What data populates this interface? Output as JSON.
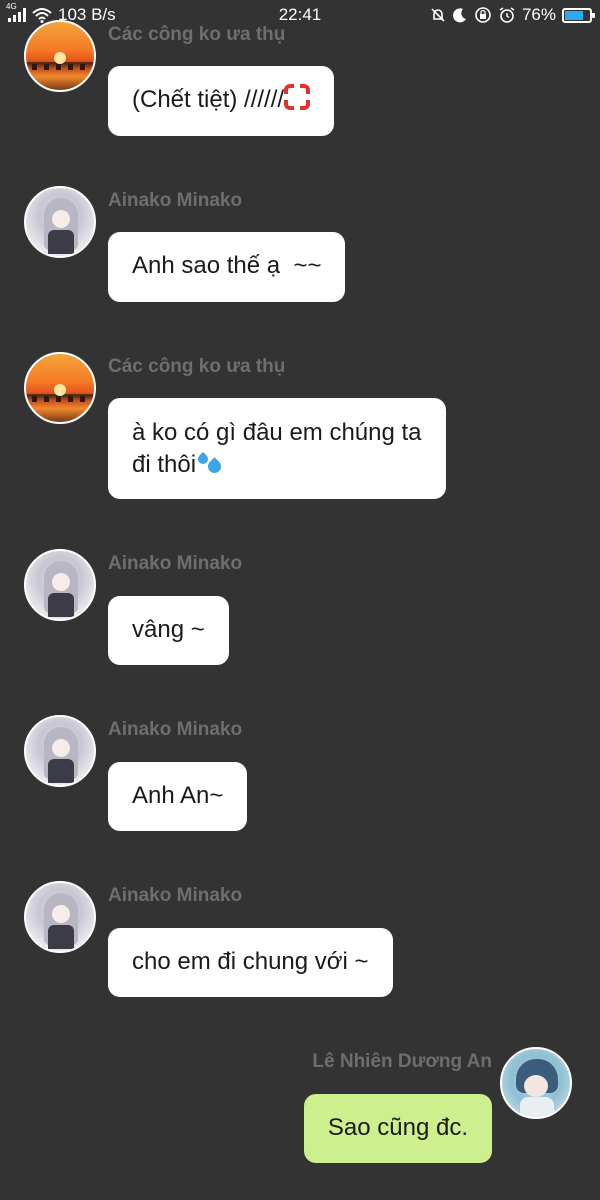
{
  "status_bar": {
    "network": "4G",
    "speed": "103 B/s",
    "time": "22:41",
    "battery": "76%",
    "battery_level": 0.76,
    "battery_color": "#2aa9f5",
    "icons": [
      "signal-icon",
      "wifi-icon",
      "alarm-off-icon",
      "moon-icon",
      "rotation-lock-icon",
      "alarm-clock-icon",
      "battery-icon"
    ]
  },
  "theme": {
    "background": "#333333",
    "bubble_other": "#ffffff",
    "bubble_me": "#cdef8e",
    "sender_name_color": "#6e6e6e"
  },
  "messages": [
    {
      "sender": "Các công ko ưa thụ",
      "text": "(Chết tiệt) //////",
      "emoji": "anger-icon",
      "avatar": "sunset-avatar",
      "mine": false
    },
    {
      "sender": "Ainako Minako",
      "text": "Anh sao thế ạ  ~~",
      "avatar": "anime-girl-avatar",
      "mine": false
    },
    {
      "sender": "Các công ko ưa thụ",
      "text_line1": "à ko có gì đâu em chúng ta",
      "text_line2": "đi thôi",
      "emoji": "sweat-droplets-icon",
      "avatar": "sunset-avatar",
      "mine": false
    },
    {
      "sender": "Ainako Minako",
      "text": "vâng ~",
      "avatar": "anime-girl-avatar",
      "mine": false
    },
    {
      "sender": "Ainako Minako",
      "text": "Anh An~",
      "avatar": "anime-girl-avatar",
      "mine": false
    },
    {
      "sender": "Ainako Minako",
      "text": "cho em đi chung với ~",
      "avatar": "anime-girl-avatar",
      "mine": false
    },
    {
      "sender": "Lê Nhiên Dương An",
      "text": "Sao cũng đc.",
      "avatar": "anime-boy-avatar",
      "mine": true
    }
  ]
}
